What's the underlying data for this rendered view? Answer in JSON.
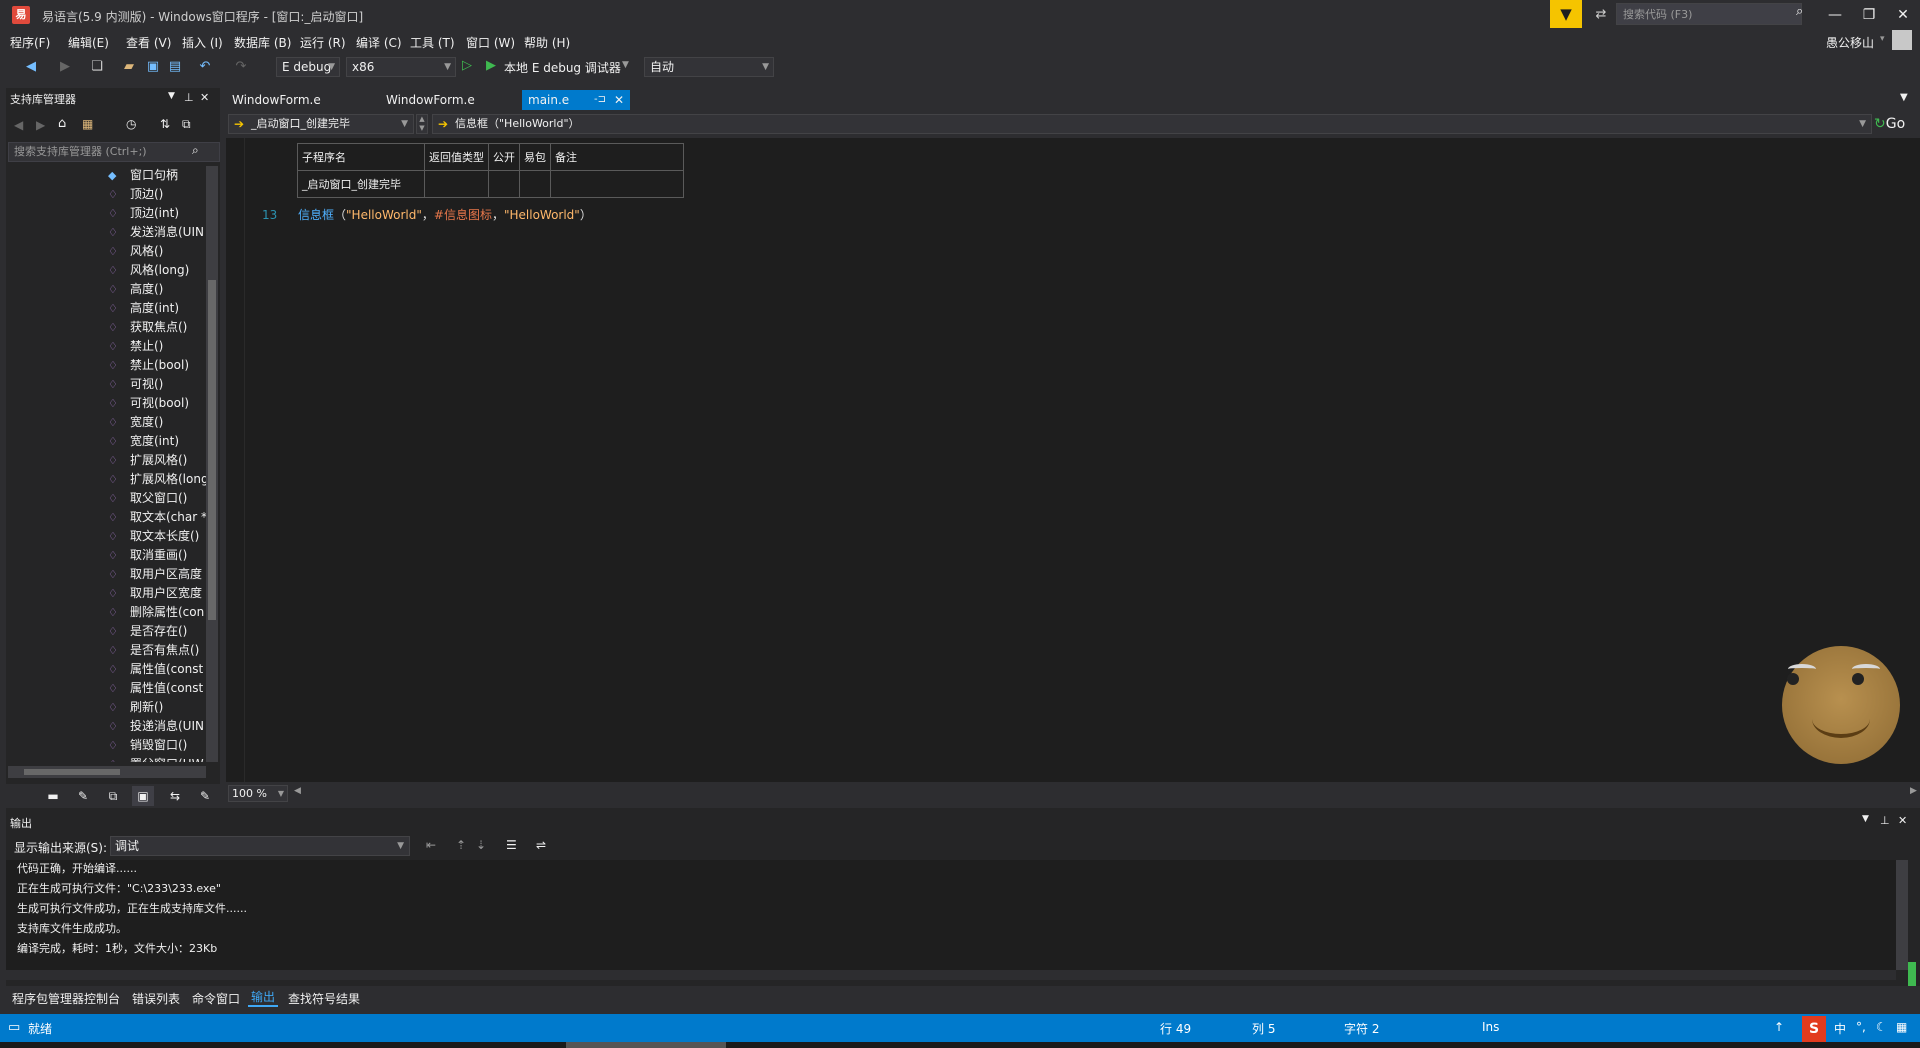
{
  "window": {
    "title": "易语言(5.9 内测版) - Windows窗口程序 - [窗口:_启动窗口]",
    "logo_glyph": "易",
    "search_placeholder": "搜索代码 (F3)",
    "min_glyph": "—",
    "max_glyph": "❐",
    "close_glyph": "✕"
  },
  "menu": [
    "程序(F)",
    "编辑(E)",
    "查看 (V)",
    "插入 (I)",
    "数据库 (B)",
    "运行 (R)",
    "编译 (C)",
    "工具 (T)",
    "窗口 (W)",
    "帮助 (H)"
  ],
  "user": {
    "name": "愚公移山",
    "dropdown": "▾"
  },
  "toolbar": {
    "config": "E debug",
    "platform": "x86",
    "run_label": "本地 E debug 调试器",
    "mode": "自动"
  },
  "left_panel": {
    "title": "支持库管理器",
    "search_placeholder": "搜索支持库管理器 (Ctrl+;)",
    "items": [
      "窗口句柄",
      "顶边()",
      "顶边(int)",
      "发送消息(UIN",
      "风格()",
      "风格(long)",
      "高度()",
      "高度(int)",
      "获取焦点()",
      "禁止()",
      "禁止(bool)",
      "可视()",
      "可视(bool)",
      "宽度()",
      "宽度(int)",
      "扩展风格()",
      "扩展风格(long",
      "取父窗口()",
      "取文本(char *",
      "取文本长度()",
      "取消重画()",
      "取用户区高度",
      "取用户区宽度",
      "删除属性(con",
      "是否存在()",
      "是否有焦点()",
      "属性值(const",
      "属性值(const",
      "刷新()",
      "投递消息(UIN",
      "销毁窗口()",
      "置父窗口(HW"
    ]
  },
  "tabs": [
    {
      "label": "WindowForm.e"
    },
    {
      "label": "WindowForm.e"
    },
    {
      "label": "main.e",
      "pin": "-⊐",
      "close": "✕"
    }
  ],
  "nav": {
    "left": "_启动窗口_创建完毕",
    "right": "信息框（\"HelloWorld\"）",
    "go": "Go"
  },
  "editor": {
    "table_headers": [
      "子程序名",
      "返回值类型",
      "公开",
      "易包",
      "备注"
    ],
    "table_row": [
      "_启动窗口_创建完毕",
      "",
      "",
      "",
      ""
    ],
    "line_number": "13",
    "code": {
      "fn": "信息框",
      "open": "（",
      "arg1": "\"HelloWorld\"",
      "comma1": "，",
      "arg2": "#信息图标",
      "comma2": "，",
      "arg3": "\"HelloWorld\"",
      "close": "）"
    },
    "zoom": "100 %"
  },
  "output": {
    "title": "输出",
    "source_label": "显示输出来源(S):",
    "source_value": "调试",
    "lines": [
      "代码正确，开始编译......",
      "正在生成可执行文件：\"C:\\233\\233.exe\"",
      "生成可执行文件成功，正在生成支持库文件......",
      "支持库文件生成成功。",
      "编译完成，耗时：1秒，文件大小：23Kb"
    ]
  },
  "bottom_tabs": [
    "程序包管理器控制台",
    "错误列表",
    "命令窗口",
    "输出",
    "查找符号结果"
  ],
  "status": {
    "ready": "就绪",
    "line": "行 49",
    "col": "列 5",
    "char": "字符 2",
    "ins": "Ins",
    "ime_s": "S",
    "ime_cn": "中"
  },
  "colors": {
    "accent": "#007acc",
    "filter": "#f5c400",
    "function": "#4fb1ff",
    "string": "#ffb86b"
  }
}
